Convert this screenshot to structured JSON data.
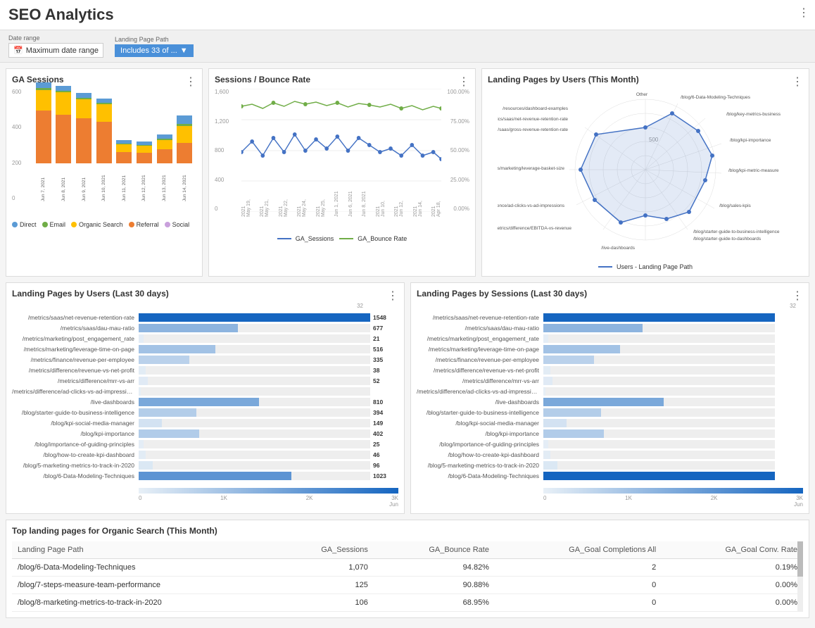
{
  "header": {
    "title": "SEO Analytics"
  },
  "filters": {
    "date_range_label": "Date range",
    "date_range_value": "Maximum date range",
    "date_range_icon": "📅",
    "landing_page_label": "Landing Page Path",
    "landing_page_value": "Includes 33 of ...",
    "dropdown_arrow": "▼"
  },
  "ga_sessions": {
    "title": "GA Sessions",
    "menu": "⋮",
    "y_labels": [
      "600",
      "400",
      "200",
      "0"
    ],
    "bars": [
      {
        "label": "Jun 7, 2021",
        "direct": 30,
        "email": 10,
        "organic": 110,
        "referral": 280,
        "social": 5
      },
      {
        "label": "Jun 8, 2021",
        "direct": 25,
        "email": 8,
        "organic": 120,
        "referral": 260,
        "social": 5
      },
      {
        "label": "Jun 9, 2021",
        "direct": 28,
        "email": 9,
        "organic": 100,
        "referral": 240,
        "social": 4
      },
      {
        "label": "Jun 10, 2021",
        "direct": 22,
        "email": 7,
        "organic": 95,
        "referral": 220,
        "social": 3
      },
      {
        "label": "Jun 11, 2021",
        "direct": 20,
        "email": 5,
        "organic": 40,
        "referral": 60,
        "social": 2
      },
      {
        "label": "Jun 12, 2021",
        "direct": 18,
        "email": 5,
        "organic": 38,
        "referral": 55,
        "social": 2
      },
      {
        "label": "Jun 13, 2021",
        "direct": 22,
        "email": 6,
        "organic": 50,
        "referral": 75,
        "social": 3
      },
      {
        "label": "Jun 14, 2021",
        "direct": 45,
        "email": 12,
        "organic": 90,
        "referral": 110,
        "social": 5
      }
    ],
    "legend": [
      {
        "label": "Direct",
        "color": "#5b9bd5"
      },
      {
        "label": "Email",
        "color": "#70ad47"
      },
      {
        "label": "Organic Search",
        "color": "#ffc000"
      },
      {
        "label": "Referral",
        "color": "#ed7d31"
      },
      {
        "label": "Social",
        "color": "#c9a0dc"
      }
    ]
  },
  "sessions_bounce": {
    "title": "Sessions / Bounce Rate",
    "menu": "⋮",
    "legend": [
      {
        "label": "GA_Sessions",
        "color": "#4472c4"
      },
      {
        "label": "GA_Bounce Rate",
        "color": "#70ad47"
      }
    ]
  },
  "landing_pages_users_month": {
    "title": "Landing Pages by Users (This Month)",
    "menu": "⋮",
    "legend_label": "Users - Landing Page Path",
    "legend_color": "#4472c4"
  },
  "landing_pages_users_30": {
    "title": "Landing Pages by Users (Last 30 days)",
    "menu": "⋮",
    "rows": [
      {
        "label": "/metrics/saas/net-revenue-retention-rate",
        "value": 1548,
        "pct": 100
      },
      {
        "label": "/metrics/saas/dau-mau-ratio",
        "value": 677,
        "pct": 43
      },
      {
        "label": "/metrics/marketing/post_engagement_rate",
        "value": 21,
        "pct": 2
      },
      {
        "label": "/metrics/marketing/leverage-time-on-page",
        "value": 516,
        "pct": 33
      },
      {
        "label": "/metrics/finance/revenue-per-employee",
        "value": 335,
        "pct": 22
      },
      {
        "label": "/metrics/difference/revenue-vs-net-profit",
        "value": 38,
        "pct": 3
      },
      {
        "label": "/metrics/difference/mrr-vs-arr",
        "value": 52,
        "pct": 4
      },
      {
        "label": "/metrics/difference/ad-clicks-vs-ad-impressions",
        "value": "",
        "pct": 1
      },
      {
        "label": "/live-dashboards",
        "value": 810,
        "pct": 52
      },
      {
        "label": "/blog/starter-guide-to-business-intelligence",
        "value": 394,
        "pct": 25
      },
      {
        "label": "/blog/kpi-social-media-manager",
        "value": 149,
        "pct": 10
      },
      {
        "label": "/blog/kpi-importance",
        "value": 402,
        "pct": 26
      },
      {
        "label": "/blog/importance-of-guiding-principles",
        "value": 25,
        "pct": 2
      },
      {
        "label": "/blog/how-to-create-kpi-dashboard",
        "value": 46,
        "pct": 3
      },
      {
        "label": "/blog/5-marketing-metrics-to-track-in-2020",
        "value": 96,
        "pct": 6
      },
      {
        "label": "/blog/6-Data-Modeling-Techniques",
        "value": 1023,
        "pct": 66
      }
    ],
    "axis_labels": [
      "0",
      "1K",
      "2K",
      "3K"
    ],
    "max_label": "Jun"
  },
  "landing_pages_sessions_30": {
    "title": "Landing Pages by Sessions (Last 30 days)",
    "menu": "⋮",
    "rows": [
      {
        "label": "/metrics/saas/net-revenue-retention-rate",
        "value": "",
        "pct": 100
      },
      {
        "label": "/metrics/saas/dau-mau-ratio",
        "value": "",
        "pct": 43
      },
      {
        "label": "/metrics/marketing/post_engagement_rate",
        "value": "",
        "pct": 2
      },
      {
        "label": "/metrics/marketing/leverage-time-on-page",
        "value": "",
        "pct": 33
      },
      {
        "label": "/metrics/finance/revenue-per-employee",
        "value": "",
        "pct": 22
      },
      {
        "label": "/metrics/difference/revenue-vs-net-profit",
        "value": "",
        "pct": 3
      },
      {
        "label": "/metrics/difference/mrr-vs-arr",
        "value": "",
        "pct": 4
      },
      {
        "label": "/metrics/difference/ad-clicks-vs-ad-impressions",
        "value": "",
        "pct": 1
      },
      {
        "label": "/live-dashboards",
        "value": "",
        "pct": 52
      },
      {
        "label": "/blog/starter-guide-to-business-intelligence",
        "value": "",
        "pct": 25
      },
      {
        "label": "/blog/kpi-social-media-manager",
        "value": "",
        "pct": 10
      },
      {
        "label": "/blog/kpi-importance",
        "value": "",
        "pct": 26
      },
      {
        "label": "/blog/importance-of-guiding-principles",
        "value": "",
        "pct": 2
      },
      {
        "label": "/blog/how-to-create-kpi-dashboard",
        "value": "",
        "pct": 3
      },
      {
        "label": "/blog/5-marketing-metrics-to-track-in-2020",
        "value": "",
        "pct": 6
      },
      {
        "label": "/blog/6-Data-Modeling-Techniques",
        "value": "",
        "pct": 100
      }
    ],
    "axis_labels": [
      "0",
      "1K",
      "2K",
      "3K"
    ],
    "max_label": "Jun"
  },
  "top_landing_pages": {
    "title": "Top landing pages for Organic Search (This Month)",
    "menu": "⋮",
    "columns": [
      "Landing Page Path",
      "GA_Sessions",
      "GA_Bounce Rate",
      "GA_Goal Completions All",
      "GA_Goal Conv. Rate"
    ],
    "rows": [
      {
        "path": "/blog/6-Data-Modeling-Techniques",
        "sessions": "1,070",
        "bounce_rate": "94.82%",
        "goal_completions": "2",
        "conv_rate": "0.19%"
      },
      {
        "path": "/blog/7-steps-measure-team-performance",
        "sessions": "125",
        "bounce_rate": "90.88%",
        "goal_completions": "0",
        "conv_rate": "0.00%"
      },
      {
        "path": "/blog/8-marketing-metrics-to-track-in-2020",
        "sessions": "106",
        "bounce_rate": "68.95%",
        "goal_completions": "0",
        "conv_rate": "0.00%"
      }
    ]
  },
  "icons": {
    "menu": "⋮",
    "calendar": "📅",
    "dropdown": "▼"
  }
}
